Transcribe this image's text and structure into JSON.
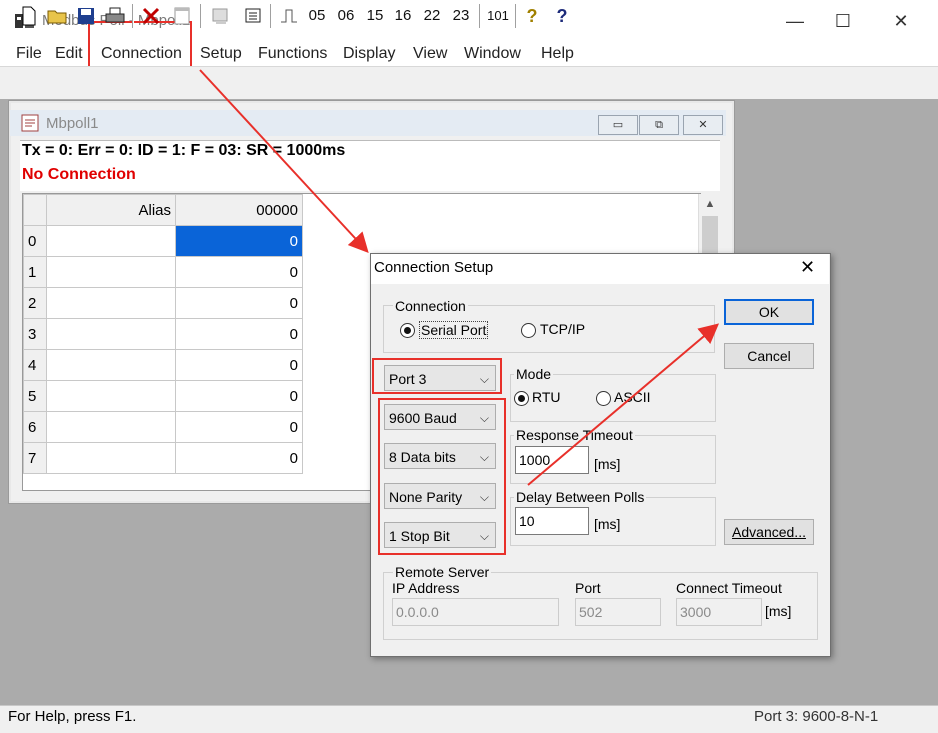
{
  "window": {
    "title": "Modbus Poll - Mbpoll1",
    "minimize": "—",
    "maximize": "☐",
    "close": "✕"
  },
  "menu": [
    "File",
    "Edit",
    "Connection",
    "Setup",
    "Functions",
    "Display",
    "View",
    "Window",
    "Help"
  ],
  "toolbar": {
    "fc": [
      "05",
      "06",
      "15",
      "16",
      "22",
      "23"
    ],
    "fc101": "101",
    "help": "?",
    "whatsthis": "?"
  },
  "child": {
    "title": "Mbpoll1",
    "status": "Tx = 0: Err = 0: ID = 1: F = 03: SR = 1000ms",
    "connection_status": "No Connection",
    "columns": [
      "Alias",
      "00000"
    ],
    "rows": [
      {
        "index": "0",
        "alias": "",
        "value": "0"
      },
      {
        "index": "1",
        "alias": "",
        "value": "0"
      },
      {
        "index": "2",
        "alias": "",
        "value": "0"
      },
      {
        "index": "3",
        "alias": "",
        "value": "0"
      },
      {
        "index": "4",
        "alias": "",
        "value": "0"
      },
      {
        "index": "5",
        "alias": "",
        "value": "0"
      },
      {
        "index": "6",
        "alias": "",
        "value": "0"
      },
      {
        "index": "7",
        "alias": "",
        "value": "0"
      }
    ]
  },
  "statusbar": {
    "help": "For Help, press F1.",
    "port": "Port 3: 9600-8-N-1"
  },
  "dialog": {
    "title": "Connection Setup",
    "close": "✕",
    "connection_group": "Connection",
    "serial_port": "Serial Port",
    "tcp_ip": "TCP/IP",
    "port": "Port 3",
    "baud": "9600 Baud",
    "data_bits": "8 Data bits",
    "parity": "None Parity",
    "stop_bit": "1 Stop Bit",
    "mode_group": "Mode",
    "rtu": "RTU",
    "ascii": "ASCII",
    "response_timeout_label": "Response Timeout",
    "response_timeout": "1000",
    "ms": "[ms]",
    "delay_label": "Delay Between Polls",
    "delay": "10",
    "ok": "OK",
    "cancel": "Cancel",
    "advanced": "Advanced...",
    "remote_group": "Remote Server",
    "ip_label": "IP Address",
    "ip": "0.0.0.0",
    "port_label": "Port",
    "port_value": "502",
    "connect_timeout_label": "Connect Timeout",
    "connect_timeout": "3000"
  },
  "colors": {
    "highlight": "#e8302a",
    "selection": "#0a64d8",
    "error_text": "#e00000"
  }
}
